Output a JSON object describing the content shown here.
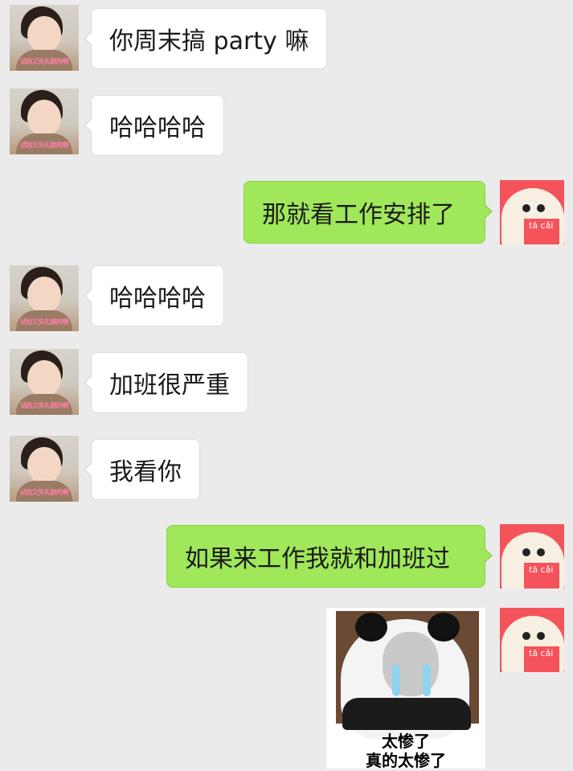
{
  "messages": [
    {
      "side": "left",
      "text": "你周末搞 party 嘛"
    },
    {
      "side": "left",
      "text": "哈哈哈哈"
    },
    {
      "side": "right",
      "text": "那就看工作安排了"
    },
    {
      "side": "left",
      "text": "哈哈哈哈"
    },
    {
      "side": "left",
      "text": "加班很严重"
    },
    {
      "side": "left",
      "text": "我看你"
    },
    {
      "side": "right",
      "text": "如果来工作我就和加班过"
    }
  ],
  "left_avatar_watermark": "试拍又失礼貌的啊",
  "right_avatar_text": "tā cǎi",
  "sticker": {
    "line1": "太惨了",
    "line2": "真的太惨了"
  },
  "colors": {
    "background": "#ebebeb",
    "self_bubble": "#a0e75a",
    "other_bubble": "#ffffff",
    "right_avatar": "#f5535b"
  }
}
